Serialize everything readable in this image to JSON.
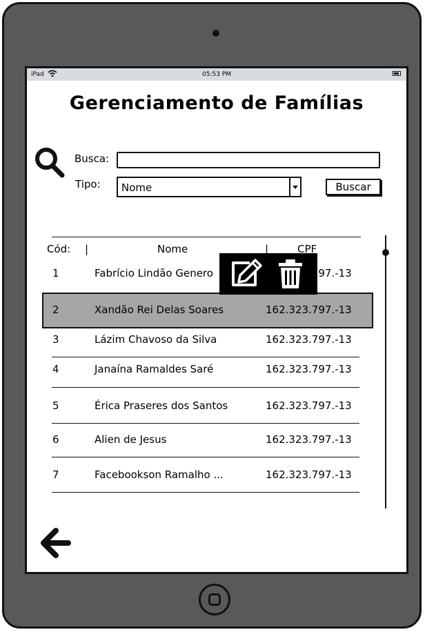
{
  "status_bar": {
    "device": "iPad",
    "time": "05:53 PM"
  },
  "header": {
    "title": "Gerenciamento de Famílias"
  },
  "search": {
    "busca_label": "Busca:",
    "busca_value": "",
    "tipo_label": "Tipo:",
    "tipo_value": "Nome",
    "buscar_button": "Buscar"
  },
  "table": {
    "headers": {
      "cod": "Cód:",
      "sep1": "|",
      "nome": "Nome",
      "sep2": "|",
      "cpf": "CPF"
    },
    "rows": [
      {
        "cod": "1",
        "nome": "Fabrício Lindão Genero",
        "cpf": "162.323.797.-13"
      },
      {
        "cod": "2",
        "nome": "Xandão Rei Delas Soares",
        "cpf": "162.323.797.-13"
      },
      {
        "cod": "3",
        "nome": "Lázim Chavoso da Silva",
        "cpf": "162.323.797.-13"
      },
      {
        "cod": "4",
        "nome": "Janaína Ramaldes Saré",
        "cpf": "162.323.797.-13"
      },
      {
        "cod": "5",
        "nome": "Érica Praseres dos Santos",
        "cpf": "162.323.797.-13"
      },
      {
        "cod": "6",
        "nome": "Alien de Jesus",
        "cpf": "162.323.797.-13"
      },
      {
        "cod": "7",
        "nome": "Facebookson Ramalho ...",
        "cpf": "162.323.797.-13"
      }
    ],
    "selected_row": 2
  },
  "icons": {
    "search": "search-icon",
    "edit": "edit-icon",
    "delete": "trash-icon",
    "back": "arrow-left-icon",
    "wifi": "wifi-icon",
    "battery": "battery-icon"
  }
}
